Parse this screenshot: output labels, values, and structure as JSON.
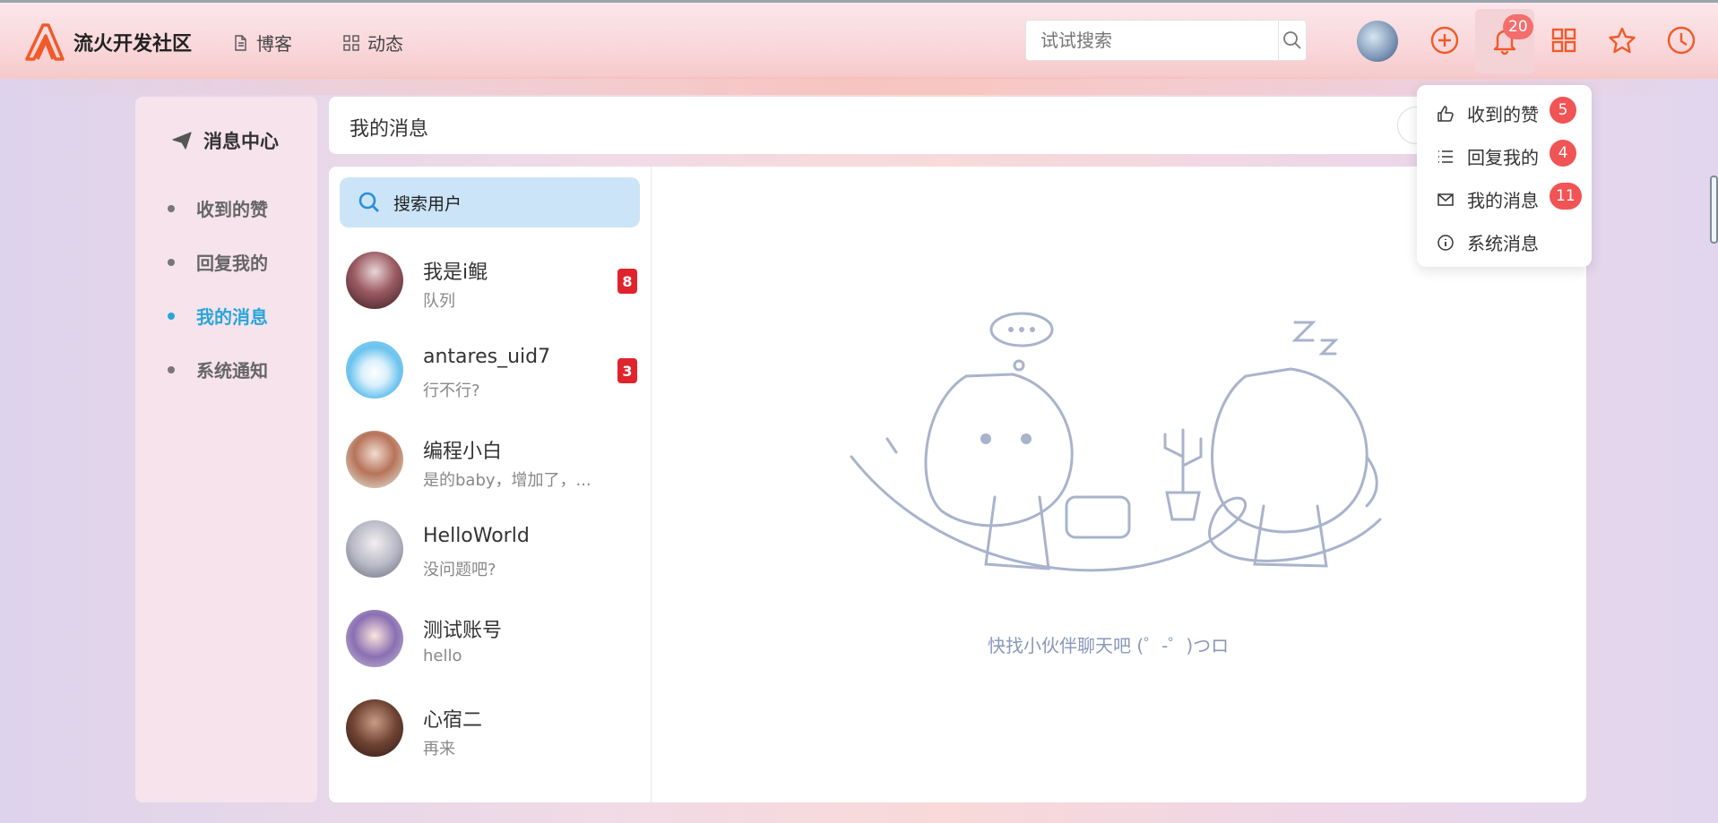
{
  "brand": {
    "name": "流火开发社区",
    "accent": "#f05a28"
  },
  "nav": {
    "blog": "博客",
    "feed": "动态"
  },
  "search": {
    "placeholder": "试试搜索"
  },
  "notifications": {
    "count": "20"
  },
  "sidebar": {
    "title": "消息中心",
    "items": [
      {
        "label": "收到的赞",
        "active": false
      },
      {
        "label": "回复我的",
        "active": false
      },
      {
        "label": "我的消息",
        "active": true
      },
      {
        "label": "系统通知",
        "active": false
      }
    ]
  },
  "header": {
    "title": "我的消息"
  },
  "contacts": {
    "search_label": "搜索用户",
    "list": [
      {
        "name": "我是i鲲",
        "preview": "队列",
        "badge": "8"
      },
      {
        "name": "antares_uid7",
        "preview": "行不行?",
        "badge": "3"
      },
      {
        "name": "编程小白",
        "preview": "是的baby，增加了，...",
        "badge": ""
      },
      {
        "name": "HelloWorld",
        "preview": "没问题吧?",
        "badge": ""
      },
      {
        "name": "测试账号",
        "preview": "hello",
        "badge": ""
      },
      {
        "name": "心宿二",
        "preview": "再来",
        "badge": ""
      }
    ]
  },
  "empty_state": {
    "text": "快找小伙伴聊天吧 (゜-゜)つロ"
  },
  "dropdown": {
    "items": [
      {
        "label": "收到的赞",
        "badge": "5",
        "icon": "thumbs-up-icon"
      },
      {
        "label": "回复我的",
        "badge": "4",
        "icon": "list-icon"
      },
      {
        "label": "我的消息",
        "badge": "11",
        "icon": "mail-icon"
      },
      {
        "label": "系统消息",
        "badge": "",
        "icon": "info-icon"
      }
    ]
  }
}
